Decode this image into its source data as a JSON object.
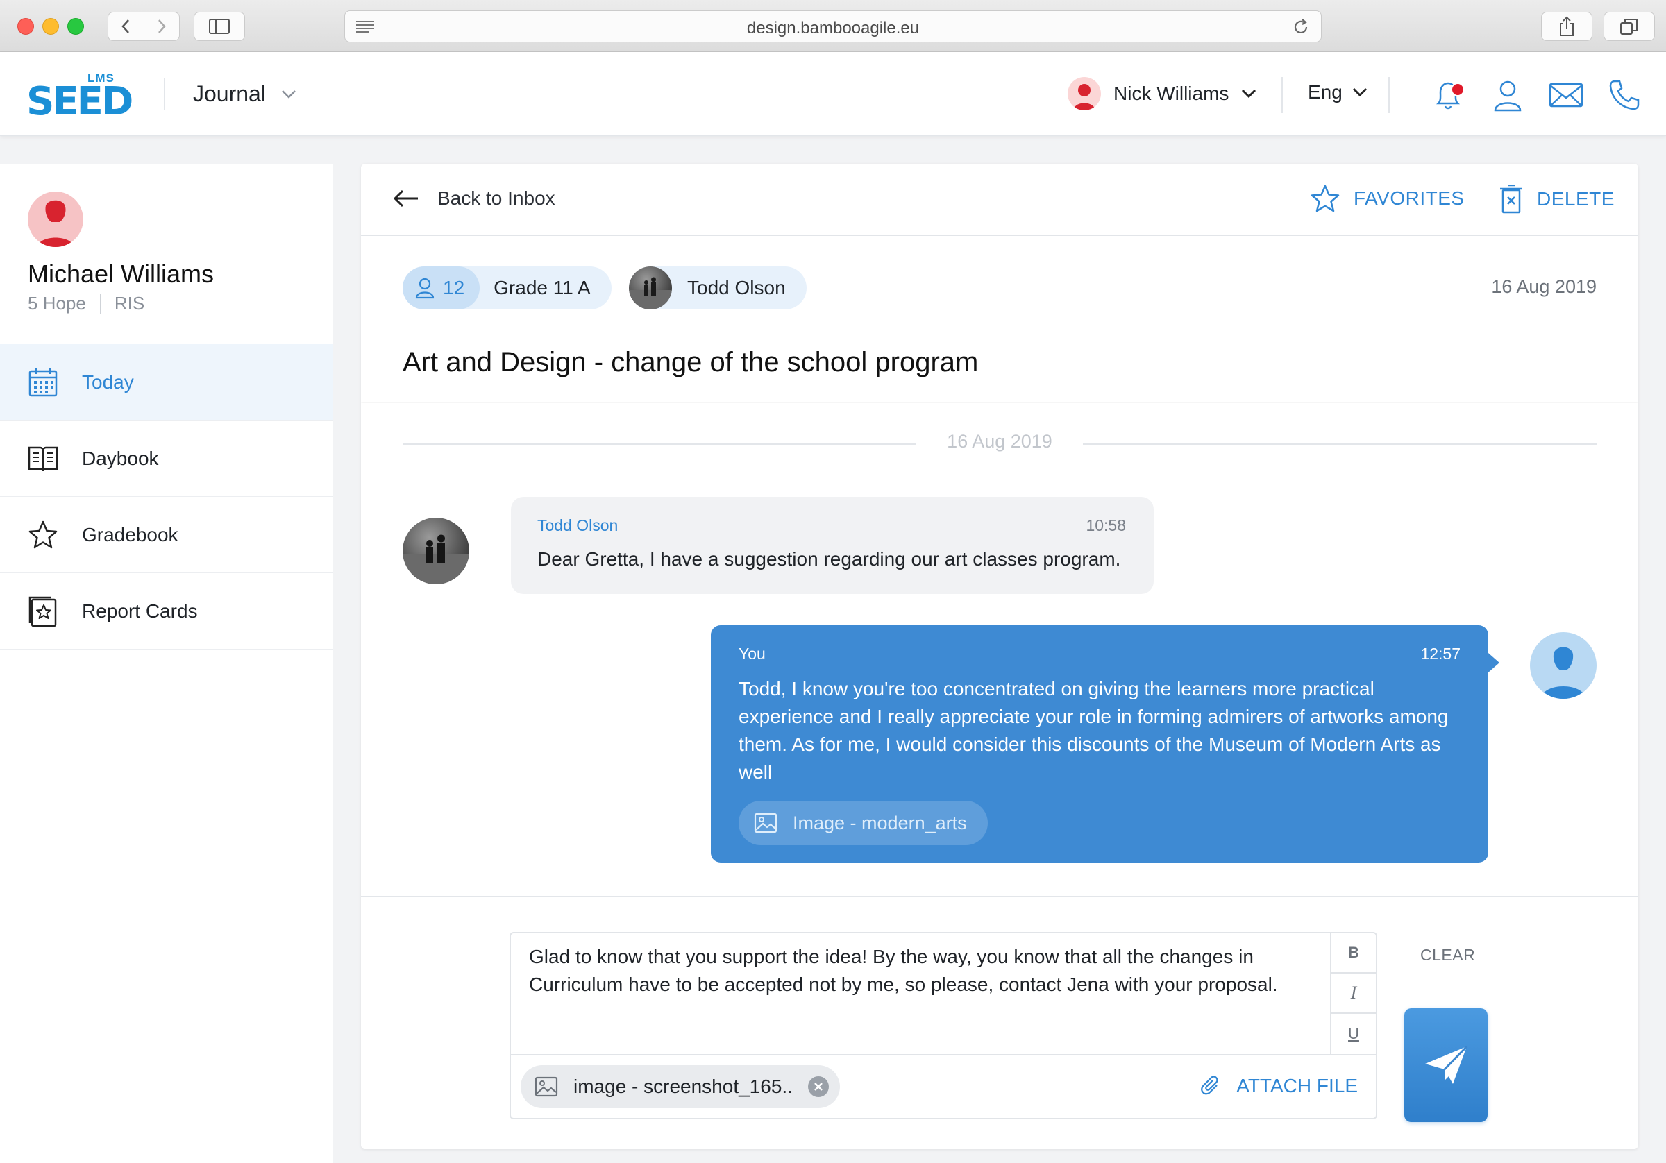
{
  "browser": {
    "url": "design.bambooagile.eu"
  },
  "header": {
    "logo_badge": "LMS",
    "logo_text": "SEED",
    "section": "Journal",
    "user_name": "Nick Williams",
    "language": "Eng",
    "icons": [
      "bell-icon",
      "user-icon",
      "mail-icon",
      "phone-icon"
    ],
    "accent_color": "#2f86d4",
    "notification_color": "#e0192a"
  },
  "sidebar": {
    "profile": {
      "name": "Michael Williams",
      "grade": "5 Hope",
      "school": "RIS"
    },
    "items": [
      {
        "label": "Today",
        "icon": "calendar-icon",
        "active": true
      },
      {
        "label": "Daybook",
        "icon": "book-icon",
        "active": false
      },
      {
        "label": "Gradebook",
        "icon": "star-icon",
        "active": false
      },
      {
        "label": "Report Cards",
        "icon": "report-card-icon",
        "active": false
      }
    ]
  },
  "conversation": {
    "back_label": "Back to Inbox",
    "favorites_label": "FAVORITES",
    "delete_label": "DELETE",
    "recipients_count": "12",
    "group_name": "Grade 11 A",
    "participant": "Todd Olson",
    "date": "16 Aug 2019",
    "subject": "Art and Design - change of the school program",
    "day_separator": "16 Aug 2019",
    "messages": [
      {
        "sender": "Todd Olson",
        "time": "10:58",
        "text": "Dear Gretta, I have a suggestion regarding our art classes program."
      },
      {
        "sender": "You",
        "time": "12:57",
        "text": "Todd, I know you're too concentrated on giving the learners more practical experience and I really appreciate your role in forming admirers of artworks among them. As for me, I would consider this discounts of the Museum of Modern Arts as well",
        "attachment": "Image - modern_arts"
      }
    ]
  },
  "composer": {
    "text": "Glad to know that you support the idea! By the way, you know that all the changes in Curriculum have to be accepted not by me, so please, contact Jena with your proposal.",
    "bold": "B",
    "italic": "I",
    "underline": "U",
    "attachment": "image - screenshot_165..",
    "attach_label": "ATTACH FILE",
    "clear_label": "CLEAR",
    "send_color": "#3e8ad3"
  }
}
